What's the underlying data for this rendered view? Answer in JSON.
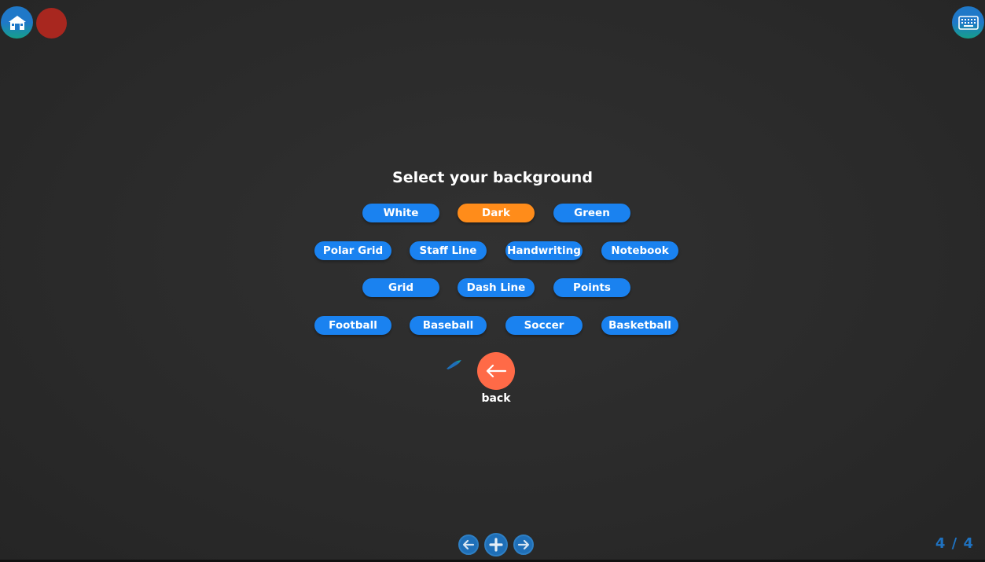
{
  "title": "Select your background",
  "options": {
    "white": "White",
    "dark": "Dark",
    "green": "Green",
    "polar_grid": "Polar Grid",
    "staff_line": "Staff Line",
    "handwriting": "Handwriting",
    "notebook": "Notebook",
    "grid": "Grid",
    "dash_line": "Dash Line",
    "points": "Points",
    "football": "Football",
    "baseball": "Baseball",
    "soccer": "Soccer",
    "basketball": "Basketball"
  },
  "selected_option": "Dark",
  "back_label": "back",
  "page_counter": "4 / 4",
  "icons": {
    "home": "home-icon",
    "record": "record-icon",
    "keyboard": "keyboard-icon",
    "back": "arrow-left-icon",
    "brush": "brush-icon",
    "prev": "arrow-left-circle-icon",
    "add": "plus-icon",
    "next": "arrow-right-circle-icon"
  },
  "colors": {
    "background": "#2b2b2b",
    "option": "#1a82f0",
    "option_selected": "#ff8c1a",
    "back_button": "#ff6a47",
    "record": "#a8271f",
    "page_counter": "#1f72c0"
  }
}
